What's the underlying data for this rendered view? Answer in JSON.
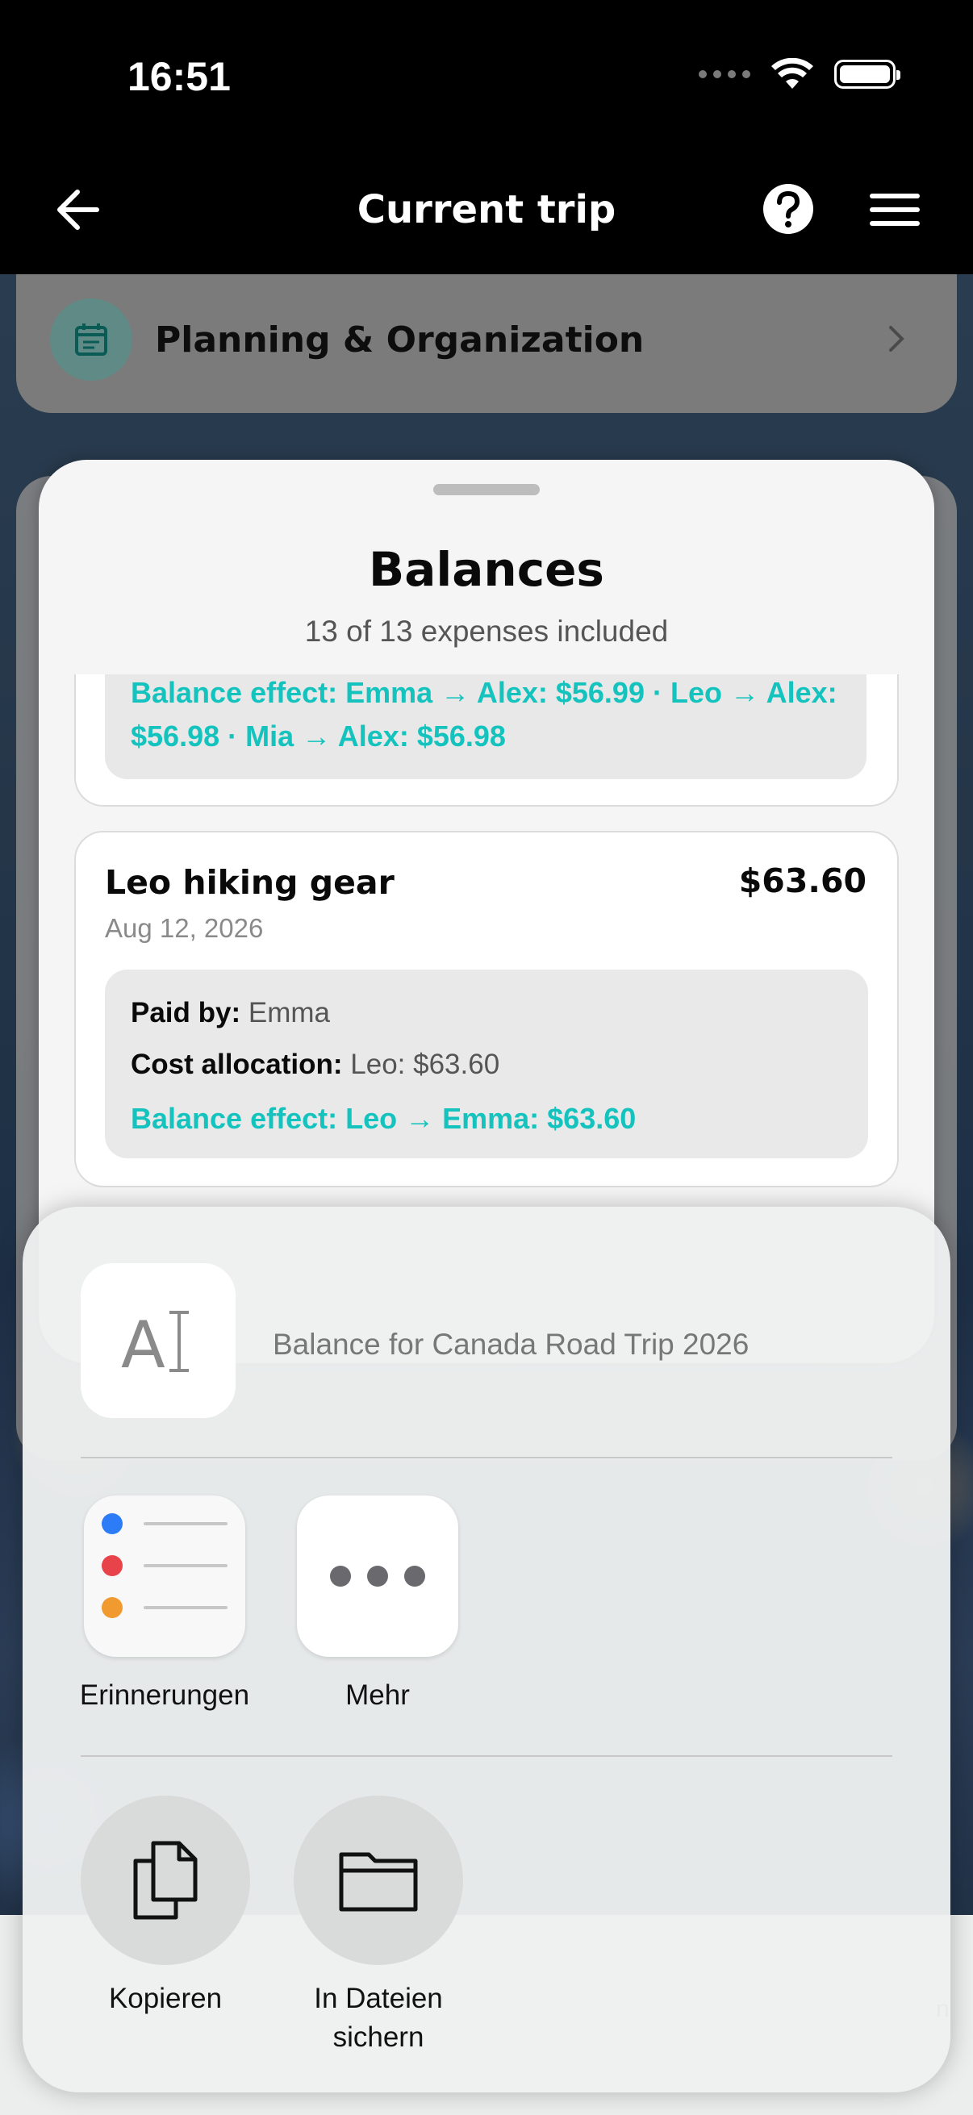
{
  "status": {
    "time": "16:51"
  },
  "nav": {
    "title": "Current trip"
  },
  "background": {
    "planning_label": "Planning & Organization",
    "tabbar_partial": "n"
  },
  "balances": {
    "title": "Balances",
    "subtitle": "13 of 13 expenses included",
    "prev_card": {
      "balance_effect_line1": "Balance effect: Emma → Alex: $56.99 · Leo → Alex:",
      "balance_effect_line2": "$56.98 · Mia → Alex: $56.98"
    },
    "expense": {
      "title": "Leo hiking gear",
      "amount": "$63.60",
      "date": "Aug 12, 2026",
      "paid_by_label": "Paid by:",
      "paid_by_value": "Emma",
      "allocation_label": "Cost allocation:",
      "allocation_value": "Leo: $63.60",
      "balance_effect": "Balance effect: Leo → Emma: $63.60"
    }
  },
  "share_sheet": {
    "file_icon_text": "AI",
    "file_title": "Balance for Canada Road Trip 2026",
    "apps": [
      {
        "label": "Erinnerungen",
        "icon": "reminders-icon"
      },
      {
        "label": "Mehr",
        "icon": "more-icon"
      }
    ],
    "actions": [
      {
        "label": "Kopieren",
        "icon": "copy-icon"
      },
      {
        "label_line1": "In Dateien",
        "label_line2": "sichern",
        "icon": "folder-icon"
      }
    ]
  }
}
